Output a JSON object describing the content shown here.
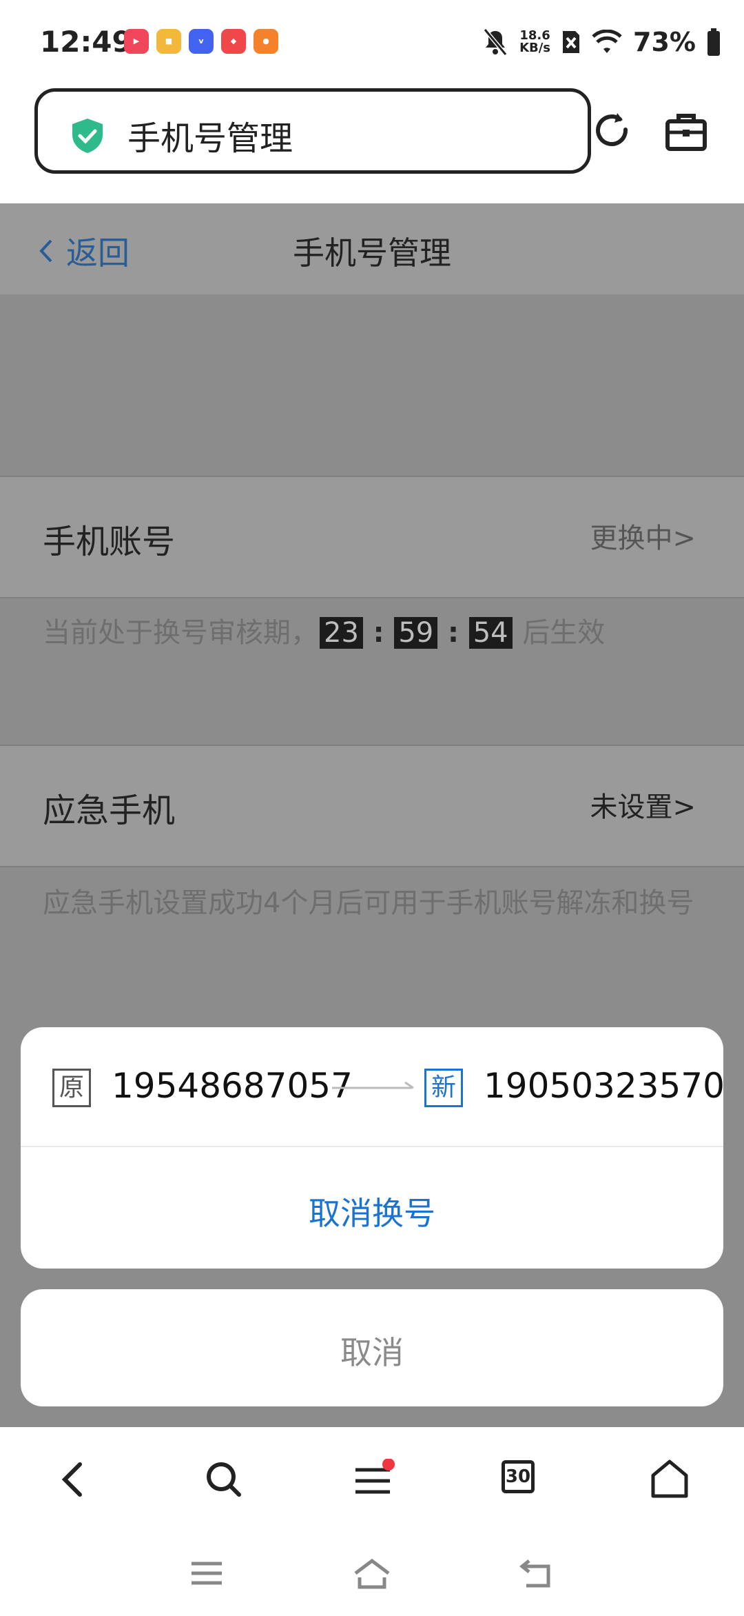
{
  "status_bar": {
    "time": "12:49",
    "speed_value": "18.6",
    "speed_unit": "KB/s",
    "battery": "73%"
  },
  "browser": {
    "url_title": "手机号管理"
  },
  "nav": {
    "back_label": "返回",
    "title": "手机号管理"
  },
  "phone_account": {
    "label": "手机账号",
    "value": "更换中>",
    "desc_prefix": "当前处于换号审核期，",
    "hours": "23",
    "minutes": "59",
    "seconds": "54",
    "colon": ":",
    "desc_suffix": "后生效"
  },
  "emergency_phone": {
    "label": "应急手机",
    "value": "未设置>",
    "desc": "应急手机设置成功4个月后可用于手机账号解冻和换号"
  },
  "dialog": {
    "old_tag": "原",
    "old_number": "19548687057",
    "new_tag": "新",
    "new_number": "19050323570",
    "action": "取消换号",
    "cancel": "取消"
  },
  "toolbar": {
    "tabs_count": "30"
  },
  "colors": {
    "accent_blue": "#1a73d0",
    "shield_green": "#2fba8c",
    "badge_red": "#f0363f"
  }
}
